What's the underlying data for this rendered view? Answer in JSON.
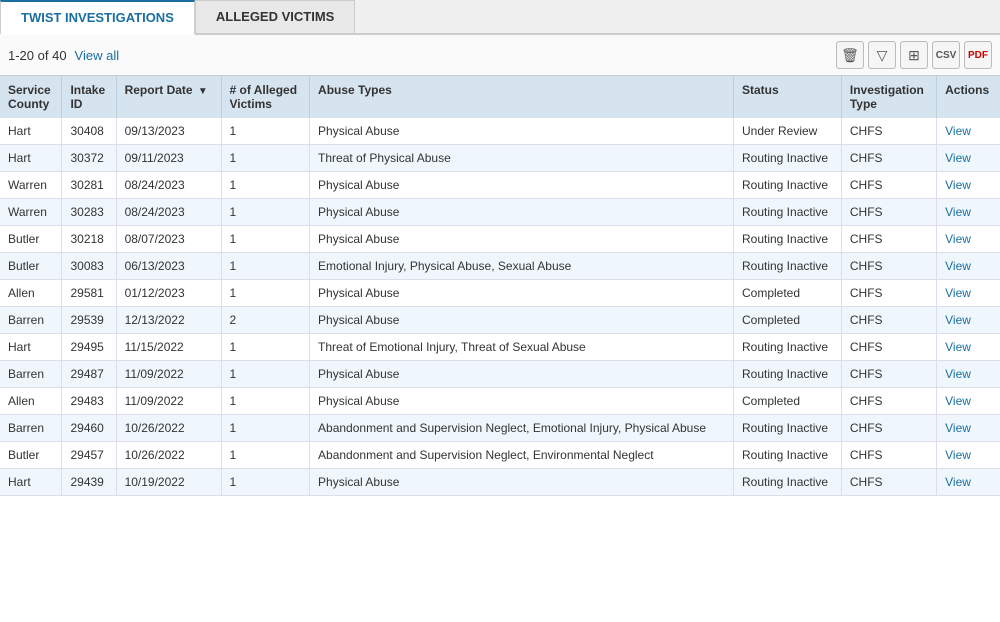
{
  "tabs": [
    {
      "label": "TWIST INVESTIGATIONS",
      "active": true
    },
    {
      "label": "ALLEGED VICTIMS",
      "active": false
    }
  ],
  "toolbar": {
    "paging": "1-20 of 40",
    "view_all": "View all"
  },
  "toolbar_icons": [
    {
      "name": "delete-icon",
      "symbol": "🗑"
    },
    {
      "name": "filter-icon",
      "symbol": "▼"
    },
    {
      "name": "columns-icon",
      "symbol": "⊞"
    },
    {
      "name": "csv-icon",
      "symbol": "CSV"
    },
    {
      "name": "pdf-icon",
      "symbol": "PDF"
    }
  ],
  "columns": [
    {
      "key": "service_county",
      "label": "Service County"
    },
    {
      "key": "intake_id",
      "label": "Intake ID"
    },
    {
      "key": "report_date",
      "label": "Report Date ▼"
    },
    {
      "key": "alleged_victims",
      "label": "# of Alleged Victims"
    },
    {
      "key": "abuse_types",
      "label": "Abuse Types"
    },
    {
      "key": "status",
      "label": "Status"
    },
    {
      "key": "investigation_type",
      "label": "Investigation Type"
    },
    {
      "key": "actions",
      "label": "Actions"
    }
  ],
  "rows": [
    {
      "service_county": "Hart",
      "intake_id": "30408",
      "report_date": "09/13/2023",
      "alleged_victims": "1",
      "abuse_types": "Physical Abuse",
      "status": "Under Review",
      "investigation_type": "CHFS",
      "actions": "View"
    },
    {
      "service_county": "Hart",
      "intake_id": "30372",
      "report_date": "09/11/2023",
      "alleged_victims": "1",
      "abuse_types": "Threat of Physical Abuse",
      "status": "Routing Inactive",
      "investigation_type": "CHFS",
      "actions": "View"
    },
    {
      "service_county": "Warren",
      "intake_id": "30281",
      "report_date": "08/24/2023",
      "alleged_victims": "1",
      "abuse_types": "Physical Abuse",
      "status": "Routing Inactive",
      "investigation_type": "CHFS",
      "actions": "View"
    },
    {
      "service_county": "Warren",
      "intake_id": "30283",
      "report_date": "08/24/2023",
      "alleged_victims": "1",
      "abuse_types": "Physical Abuse",
      "status": "Routing Inactive",
      "investigation_type": "CHFS",
      "actions": "View"
    },
    {
      "service_county": "Butler",
      "intake_id": "30218",
      "report_date": "08/07/2023",
      "alleged_victims": "1",
      "abuse_types": "Physical Abuse",
      "status": "Routing Inactive",
      "investigation_type": "CHFS",
      "actions": "View"
    },
    {
      "service_county": "Butler",
      "intake_id": "30083",
      "report_date": "06/13/2023",
      "alleged_victims": "1",
      "abuse_types": "Emotional Injury, Physical Abuse, Sexual Abuse",
      "status": "Routing Inactive",
      "investigation_type": "CHFS",
      "actions": "View"
    },
    {
      "service_county": "Allen",
      "intake_id": "29581",
      "report_date": "01/12/2023",
      "alleged_victims": "1",
      "abuse_types": "Physical Abuse",
      "status": "Completed",
      "investigation_type": "CHFS",
      "actions": "View"
    },
    {
      "service_county": "Barren",
      "intake_id": "29539",
      "report_date": "12/13/2022",
      "alleged_victims": "2",
      "abuse_types": "Physical Abuse",
      "status": "Completed",
      "investigation_type": "CHFS",
      "actions": "View"
    },
    {
      "service_county": "Hart",
      "intake_id": "29495",
      "report_date": "11/15/2022",
      "alleged_victims": "1",
      "abuse_types": "Threat of Emotional Injury, Threat of Sexual Abuse",
      "status": "Routing Inactive",
      "investigation_type": "CHFS",
      "actions": "View"
    },
    {
      "service_county": "Barren",
      "intake_id": "29487",
      "report_date": "11/09/2022",
      "alleged_victims": "1",
      "abuse_types": "Physical Abuse",
      "status": "Routing Inactive",
      "investigation_type": "CHFS",
      "actions": "View"
    },
    {
      "service_county": "Allen",
      "intake_id": "29483",
      "report_date": "11/09/2022",
      "alleged_victims": "1",
      "abuse_types": "Physical Abuse",
      "status": "Completed",
      "investigation_type": "CHFS",
      "actions": "View"
    },
    {
      "service_county": "Barren",
      "intake_id": "29460",
      "report_date": "10/26/2022",
      "alleged_victims": "1",
      "abuse_types": "Abandonment and Supervision Neglect, Emotional Injury, Physical Abuse",
      "status": "Routing Inactive",
      "investigation_type": "CHFS",
      "actions": "View"
    },
    {
      "service_county": "Butler",
      "intake_id": "29457",
      "report_date": "10/26/2022",
      "alleged_victims": "1",
      "abuse_types": "Abandonment and Supervision Neglect, Environmental Neglect",
      "status": "Routing Inactive",
      "investigation_type": "CHFS",
      "actions": "View"
    },
    {
      "service_county": "Hart",
      "intake_id": "29439",
      "report_date": "10/19/2022",
      "alleged_victims": "1",
      "abuse_types": "Physical Abuse",
      "status": "Routing Inactive",
      "investigation_type": "CHFS",
      "actions": "View"
    }
  ]
}
